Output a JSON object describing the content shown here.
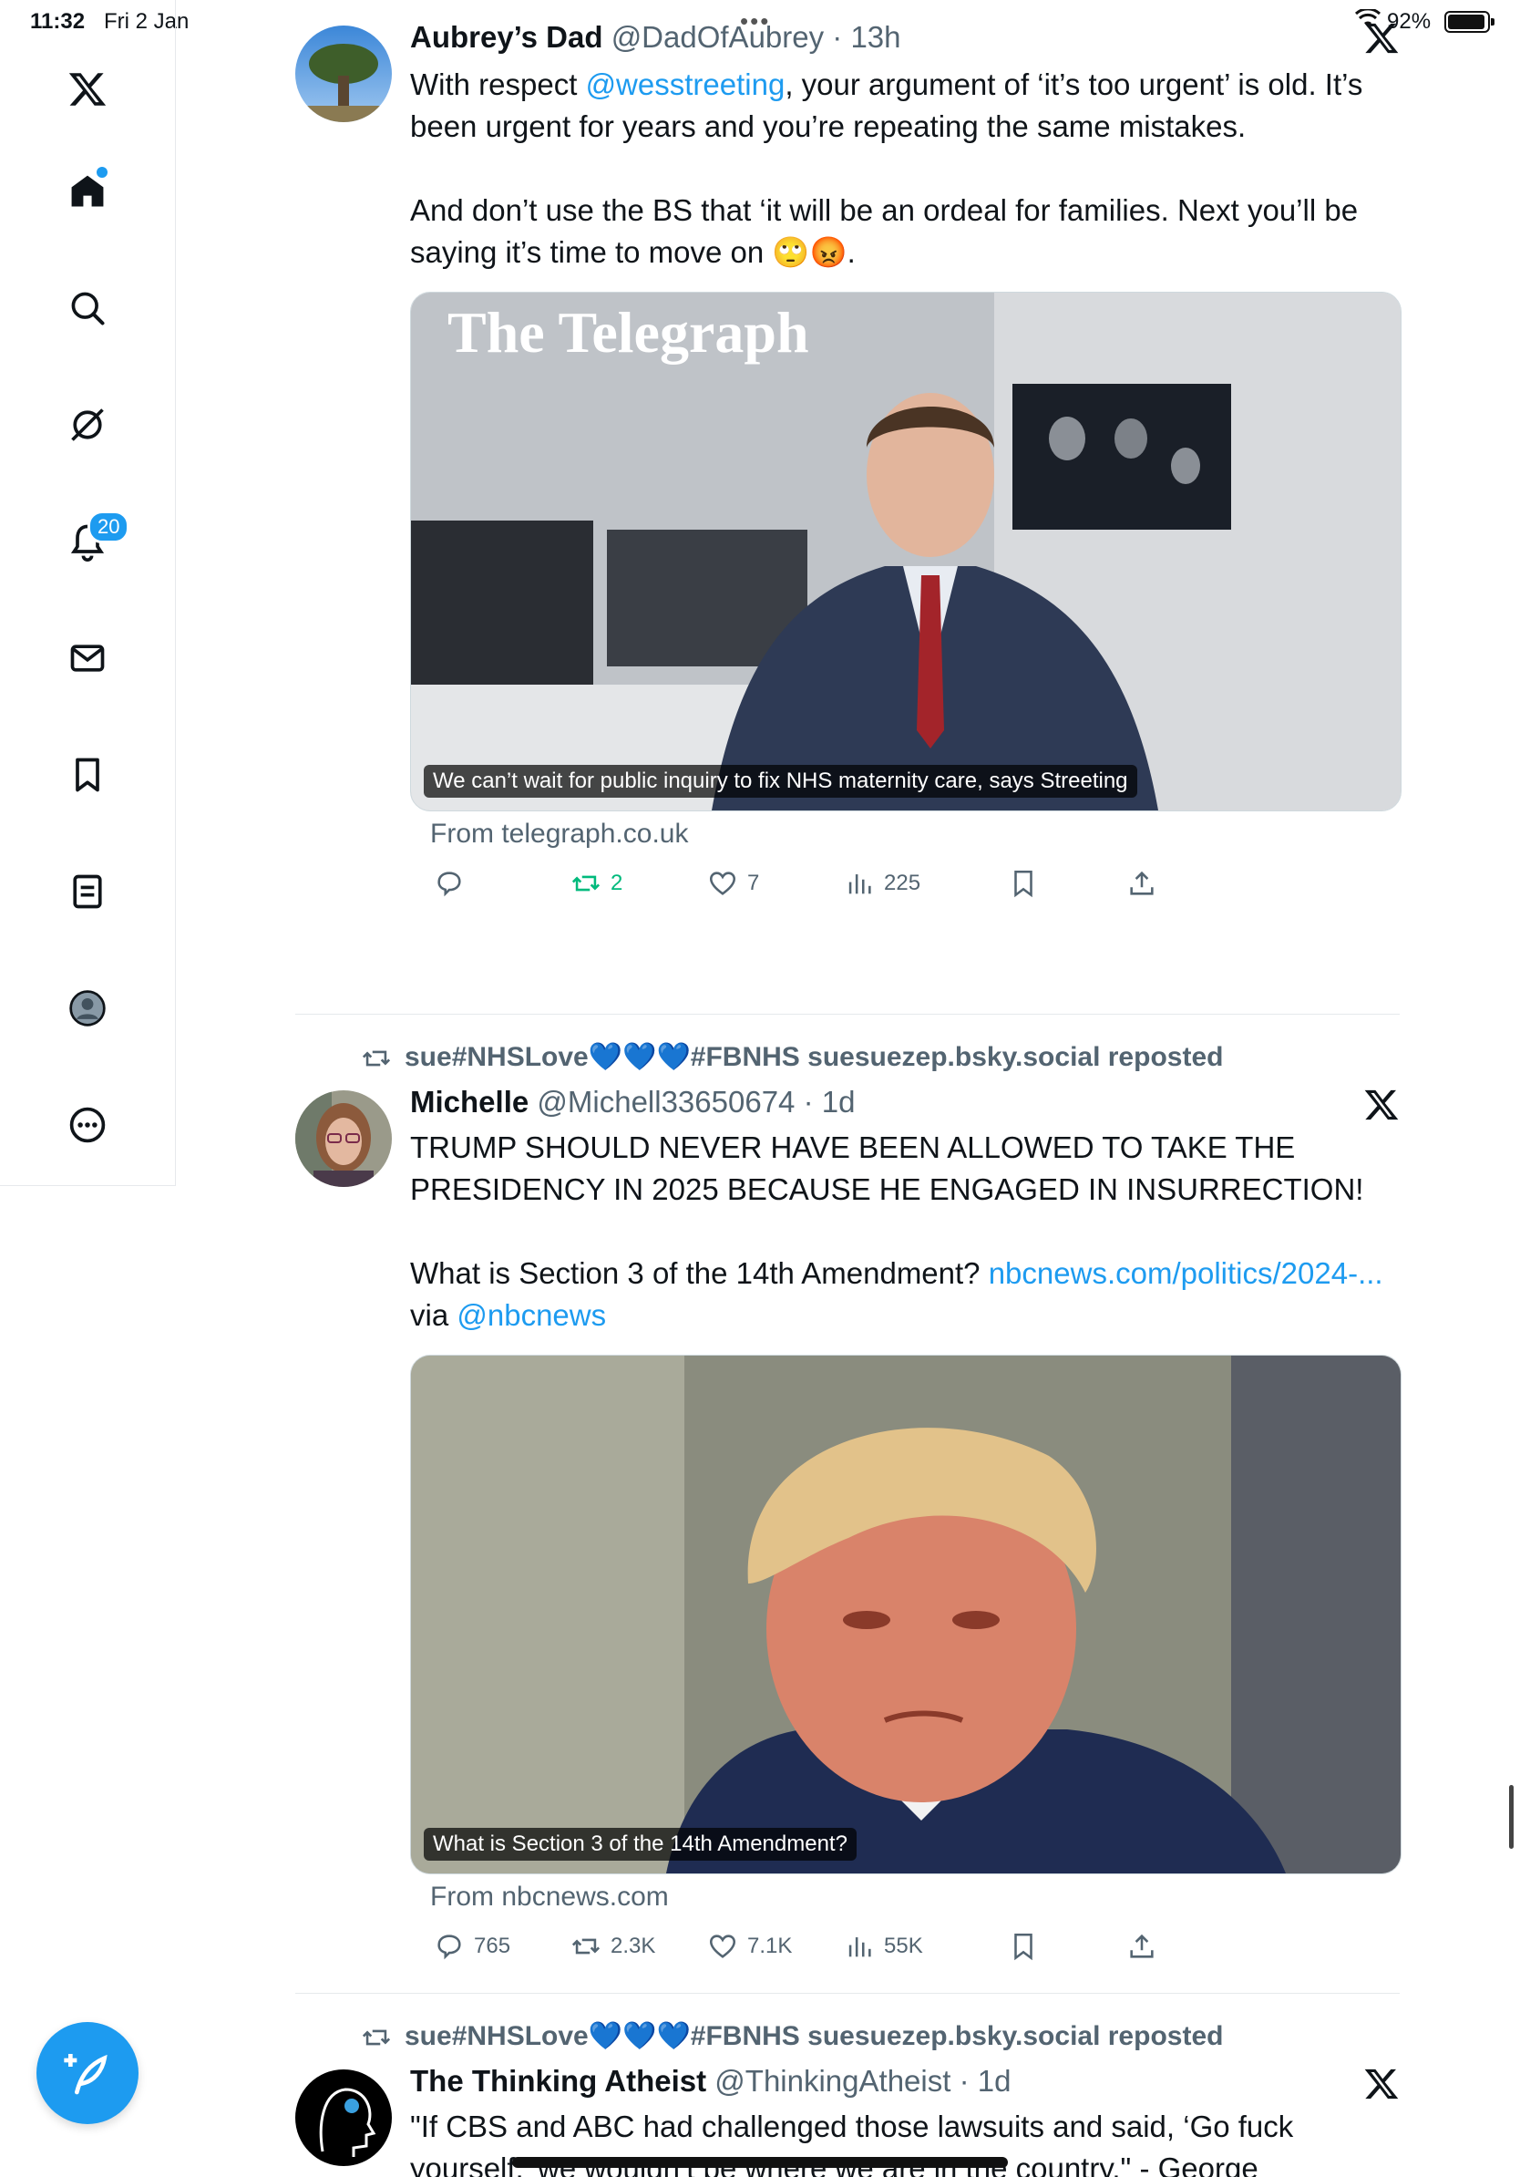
{
  "status_bar": {
    "time": "11:32",
    "date": "Fri 2 Jan",
    "battery_percent": "92%",
    "battery_level": 0.92
  },
  "sidebar": {
    "items": [
      {
        "name": "home",
        "icon": "home-icon"
      },
      {
        "name": "search",
        "icon": "search-icon"
      },
      {
        "name": "grok",
        "icon": "grok-icon"
      },
      {
        "name": "notifications",
        "icon": "bell-icon",
        "badge": "20"
      },
      {
        "name": "messages",
        "icon": "mail-icon"
      },
      {
        "name": "bookmarks",
        "icon": "bookmark-icon"
      },
      {
        "name": "lists",
        "icon": "list-icon"
      },
      {
        "name": "profile",
        "icon": "profile-icon"
      },
      {
        "name": "more",
        "icon": "more-icon"
      }
    ],
    "notification_badge": "20"
  },
  "tweets": [
    {
      "name": "Aubrey’s Dad",
      "handle": "@DadOfAubrey",
      "time": "· 13h",
      "text_pre": "With respect ",
      "mention": "@wesstreeting",
      "text_post": ", your argument of ‘it’s too urgent’ is old. It’s been urgent for years and you’re repeating the same mistakes.",
      "text_2": "And don’t use the BS that ‘it will be an ordeal for families.  Next you’ll be saying it’s time to move on 🙄😡.",
      "card_logo": "The Telegraph",
      "card_caption": "We can’t wait for public inquiry to fix NHS maternity care, says Streeting",
      "card_from": "From telegraph.co.uk",
      "replies": "",
      "reposts": "2",
      "likes": "7",
      "views": "225"
    },
    {
      "reposted_by": "sue#NHSLove💙💙💙#FBNHS suesuezep.bsky.social reposted",
      "name": "Michelle",
      "handle": "@Michell33650674",
      "time": "· 1d",
      "text_1": "TRUMP SHOULD NEVER HAVE BEEN ALLOWED TO TAKE THE PRESIDENCY IN 2025 BECAUSE HE ENGAGED IN INSURRECTION!",
      "text_2_pre": "What is Section 3 of the 14th Amendment? ",
      "link": "nbcnews.com/politics/2024-...",
      "via": " via ",
      "via_mention": "@nbcnews",
      "card_caption": "What is Section 3 of the 14th Amendment?",
      "card_from": "From nbcnews.com",
      "replies": "765",
      "reposts": "2.3K",
      "likes": "7.1K",
      "views": "55K"
    },
    {
      "reposted_by": "sue#NHSLove💙💙💙#FBNHS suesuezep.bsky.social reposted",
      "name": "The Thinking Atheist",
      "handle": "@ThinkingAtheist",
      "time": "· 1d",
      "text": "\"If CBS and ABC had challenged those lawsuits and said, ‘Go fuck yourself,’ we wouldn’t be where we are in the country.\" - George"
    }
  ]
}
